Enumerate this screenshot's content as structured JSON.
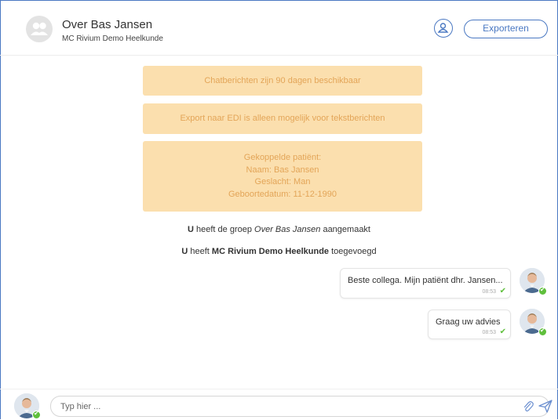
{
  "header": {
    "title": "Over Bas Jansen",
    "subtitle": "MC Rivium Demo Heelkunde",
    "export_label": "Exporteren"
  },
  "notices": [
    "Chatberichten zijn 90 dagen beschikbaar",
    "Export naar EDI is alleen mogelijk voor tekstberichten"
  ],
  "patient": {
    "line1": "Gekoppelde patiënt:",
    "line2": "Naam: Bas Jansen",
    "line3": "Geslacht: Man",
    "line4": "Geboortedatum: 11-12-1990"
  },
  "system": {
    "created_actor": "U",
    "created_pre": " heeft de groep ",
    "created_group": "Over Bas Jansen",
    "created_post": " aangemaakt",
    "added_actor": "U",
    "added_pre": " heeft ",
    "added_org": "MC Rivium Demo Heelkunde",
    "added_post": " toegevoegd"
  },
  "messages": [
    {
      "text": "Beste collega. Mijn patiënt dhr. Jansen...",
      "time": "08:53",
      "status": "✔"
    },
    {
      "text": "Graag uw advies",
      "time": "08:53",
      "status": "✔"
    }
  ],
  "composer": {
    "placeholder": "Typ hier ..."
  },
  "colors": {
    "accent": "#4a78c2",
    "notice_bg": "#fbdfae",
    "notice_text": "#e3a558",
    "online": "#5fbf3c"
  },
  "icons": [
    "group-icon",
    "profile-icon",
    "paperclip-icon",
    "send-icon",
    "check-icon",
    "online-status-icon"
  ]
}
